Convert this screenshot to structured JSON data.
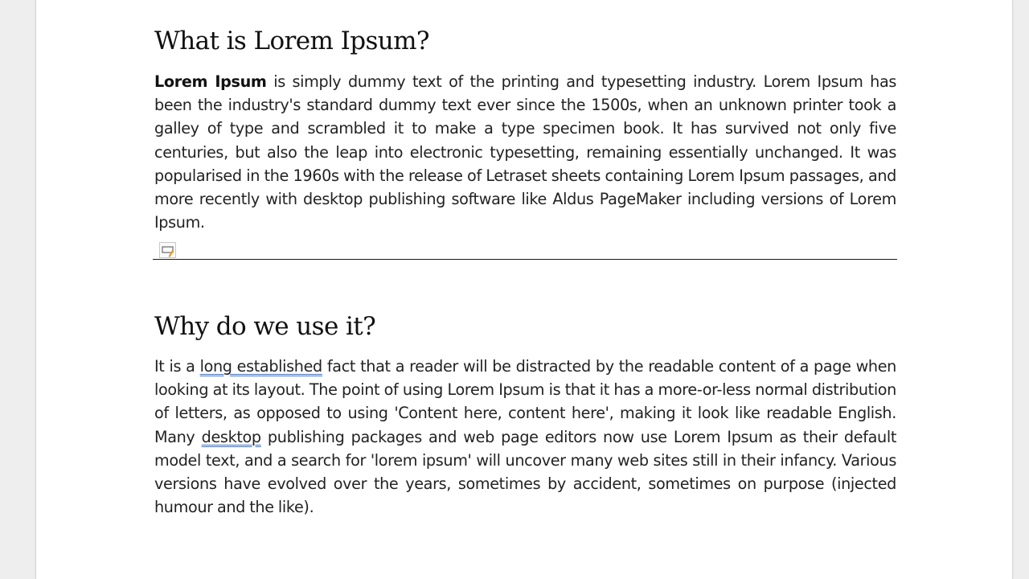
{
  "document": {
    "sections": [
      {
        "heading": "What is Lorem Ipsum?",
        "paragraph": {
          "bold_lead": "Lorem Ipsum",
          "text": " is simply dummy text of the printing and typesetting industry. Lorem Ipsum has been the industry's standard dummy text ever since the 1500s, when an unknown printer took a galley of type and scrambled it to make a type specimen book. It has survived not only five centuries, but also the leap into electronic typesetting, remaining essentially unchanged. It was popularised in the 1960s with the release of Letraset sheets containing Lorem Ipsum passages, and more recently with desktop publishing software like Aldus PageMaker including versions of Lorem Ipsum."
        }
      },
      {
        "heading": "Why do we use it?",
        "paragraph": {
          "part1": "It is a ",
          "flagged1": "long established",
          "part2": " fact that a reader will be distracted by the readable content of a page when looking at its layout. The point of using Lorem Ipsum is that it has a more-or-less normal distribution of letters, as opposed to using 'Content here, content here', making it look like readable English. Many ",
          "flagged2": "desktop",
          "part3": " publishing packages and web page editors now use Lorem Ipsum as their default model text, and a search for 'lorem ipsum' will uncover many web sites still in their infancy. Various versions have evolved over the years, sometimes by accident, sometimes on purpose (injected humour and the like)."
        }
      }
    ],
    "anchor_icon": "paragraph-anchor-edit-icon",
    "colors": {
      "page": "#ffffff",
      "workspace": "#eeeeee",
      "grammar_underline": "#4472c4",
      "text": "#222222"
    }
  }
}
